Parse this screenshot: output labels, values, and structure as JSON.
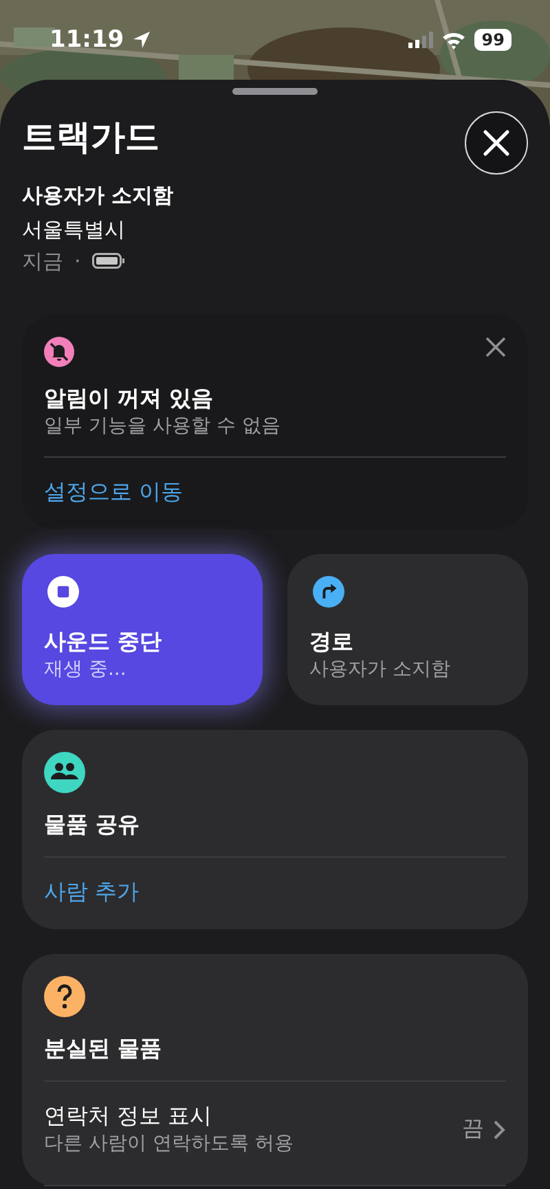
{
  "status_bar": {
    "time": "11:19",
    "battery": "99"
  },
  "header": {
    "title": "트랙가드",
    "status": "사용자가 소지함",
    "location": "서울특별시",
    "updated": "지금",
    "separator": "·"
  },
  "alert": {
    "title": "알림이 꺼져 있음",
    "subtitle": "일부 기능을 사용할 수 없음",
    "action": "설정으로 이동"
  },
  "actions": [
    {
      "kind": "sound",
      "title": "사운드 중단",
      "subtitle": "재생 중...",
      "active": true
    },
    {
      "kind": "directions",
      "title": "경로",
      "subtitle": "사용자가 소지함",
      "active": false
    }
  ],
  "sharing": {
    "title": "물품 공유",
    "action": "사람 추가"
  },
  "lost": {
    "title": "분실된 물품",
    "rows": [
      {
        "label": "연락처 정보 표시",
        "detail": "다른 사람이 연락하도록 허용",
        "value": "끔"
      }
    ]
  }
}
